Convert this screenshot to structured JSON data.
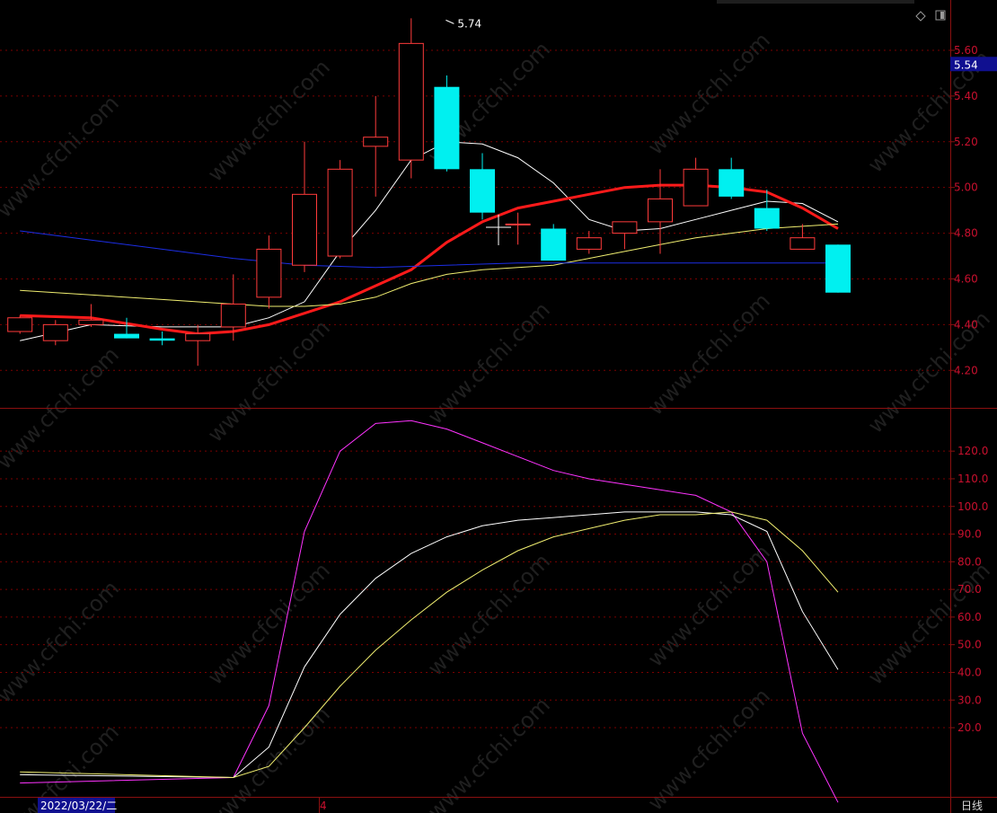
{
  "chart_data": [
    {
      "type": "candlestick",
      "panel": "price",
      "yticks": [
        4.2,
        4.4,
        4.6,
        4.8,
        5.0,
        5.2,
        5.4,
        5.6
      ],
      "ylim": [
        4.04,
        5.82
      ],
      "current_price_label": "5.54",
      "high_annotation": "5.74",
      "grid": true,
      "x": [
        -0.5,
        0.5,
        1.5,
        2.5,
        3.5,
        4.5,
        5.5,
        6.5,
        7.5,
        8.5,
        9.5,
        10.5,
        11.5,
        12.5,
        13.5,
        14.5,
        15.5,
        16.5,
        17.5,
        18.5,
        19.5,
        20.5,
        21.5,
        22.5
      ],
      "candles": [
        {
          "o": 4.37,
          "h": 4.44,
          "l": 4.36,
          "c": 4.43
        },
        {
          "o": 4.33,
          "h": 4.42,
          "l": 4.31,
          "c": 4.4
        },
        {
          "o": 4.4,
          "h": 4.49,
          "l": 4.39,
          "c": 4.42
        },
        {
          "o": 4.36,
          "h": 4.43,
          "l": 4.34,
          "c": 4.34
        },
        {
          "o": 4.34,
          "h": 4.37,
          "l": 4.31,
          "c": 4.33
        },
        {
          "o": 4.33,
          "h": 4.4,
          "l": 4.22,
          "c": 4.36
        },
        {
          "o": 4.39,
          "h": 4.62,
          "l": 4.33,
          "c": 4.49
        },
        {
          "o": 4.52,
          "h": 4.79,
          "l": 4.47,
          "c": 4.73
        },
        {
          "o": 4.66,
          "h": 5.2,
          "l": 4.63,
          "c": 4.97
        },
        {
          "o": 4.7,
          "h": 5.12,
          "l": 4.69,
          "c": 5.08
        },
        {
          "o": 5.18,
          "h": 5.4,
          "l": 4.96,
          "c": 5.22
        },
        {
          "o": 5.12,
          "h": 5.74,
          "l": 5.04,
          "c": 5.63
        },
        {
          "o": 5.44,
          "h": 5.49,
          "l": 5.07,
          "c": 5.08
        },
        {
          "o": 5.08,
          "h": 5.15,
          "l": 4.86,
          "c": 4.89
        },
        {
          "o": 4.84,
          "h": 4.89,
          "l": 4.75,
          "c": 4.84
        },
        {
          "o": 4.82,
          "h": 4.84,
          "l": 4.68,
          "c": 4.68
        },
        {
          "o": 4.73,
          "h": 4.81,
          "l": 4.71,
          "c": 4.78
        },
        {
          "o": 4.8,
          "h": 4.85,
          "l": 4.73,
          "c": 4.85
        },
        {
          "o": 4.85,
          "h": 5.08,
          "l": 4.71,
          "c": 4.95
        },
        {
          "o": 4.92,
          "h": 5.13,
          "l": 4.92,
          "c": 5.08
        },
        {
          "o": 5.08,
          "h": 5.13,
          "l": 4.95,
          "c": 4.96
        },
        {
          "o": 4.91,
          "h": 4.99,
          "l": 4.81,
          "c": 4.82
        },
        {
          "o": 4.73,
          "h": 4.84,
          "l": 4.73,
          "c": 4.78
        },
        {
          "o": 4.75,
          "h": 4.75,
          "l": 4.54,
          "c": 4.54
        }
      ],
      "series": [
        {
          "color": "#ffffff",
          "width": 1,
          "points": [
            [
              -0.5,
              4.33
            ],
            [
              1.5,
              4.4
            ],
            [
              3.5,
              4.39
            ],
            [
              5.5,
              4.39
            ],
            [
              6.5,
              4.43
            ],
            [
              7.5,
              4.5
            ],
            [
              8.5,
              4.72
            ],
            [
              9.5,
              4.9
            ],
            [
              10.5,
              5.12
            ],
            [
              11.5,
              5.2
            ],
            [
              12.5,
              5.19
            ],
            [
              13.5,
              5.13
            ],
            [
              14.5,
              5.02
            ],
            [
              15.5,
              4.86
            ],
            [
              16.5,
              4.81
            ],
            [
              17.5,
              4.82
            ],
            [
              18.5,
              4.86
            ],
            [
              19.5,
              4.9
            ],
            [
              20.5,
              4.94
            ],
            [
              21.5,
              4.93
            ],
            [
              22.5,
              4.85
            ]
          ]
        },
        {
          "color": "#ff1a1a",
          "width": 3,
          "points": [
            [
              -0.5,
              4.44
            ],
            [
              1.5,
              4.43
            ],
            [
              3.5,
              4.38
            ],
            [
              4.5,
              4.36
            ],
            [
              5.5,
              4.37
            ],
            [
              6.5,
              4.4
            ],
            [
              7.5,
              4.45
            ],
            [
              8.5,
              4.5
            ],
            [
              9.5,
              4.57
            ],
            [
              10.5,
              4.64
            ],
            [
              11.5,
              4.76
            ],
            [
              12.5,
              4.85
            ],
            [
              13.5,
              4.91
            ],
            [
              14.5,
              4.94
            ],
            [
              15.5,
              4.97
            ],
            [
              16.5,
              5.0
            ],
            [
              17.5,
              5.01
            ],
            [
              18.5,
              5.01
            ],
            [
              19.5,
              5.0
            ],
            [
              20.5,
              4.98
            ],
            [
              21.5,
              4.91
            ],
            [
              22.5,
              4.82
            ]
          ]
        },
        {
          "color": "#f0ee70",
          "width": 1,
          "points": [
            [
              -0.5,
              4.55
            ],
            [
              1.5,
              4.53
            ],
            [
              3.5,
              4.51
            ],
            [
              5.5,
              4.49
            ],
            [
              6.5,
              4.48
            ],
            [
              7.5,
              4.48
            ],
            [
              8.5,
              4.49
            ],
            [
              9.5,
              4.52
            ],
            [
              10.5,
              4.58
            ],
            [
              11.5,
              4.62
            ],
            [
              12.5,
              4.64
            ],
            [
              13.5,
              4.65
            ],
            [
              14.5,
              4.66
            ],
            [
              15.5,
              4.69
            ],
            [
              16.5,
              4.72
            ],
            [
              17.5,
              4.75
            ],
            [
              18.5,
              4.78
            ],
            [
              19.5,
              4.8
            ],
            [
              20.5,
              4.82
            ],
            [
              21.5,
              4.83
            ],
            [
              22.5,
              4.84
            ]
          ]
        },
        {
          "color": "#1c2ee6",
          "width": 1,
          "points": [
            [
              -0.5,
              4.81
            ],
            [
              1.5,
              4.77
            ],
            [
              3.5,
              4.73
            ],
            [
              5.5,
              4.69
            ],
            [
              7.5,
              4.66
            ],
            [
              9.5,
              4.65
            ],
            [
              11.5,
              4.66
            ],
            [
              13.5,
              4.67
            ],
            [
              15.5,
              4.67
            ],
            [
              17.5,
              4.67
            ],
            [
              19.5,
              4.67
            ],
            [
              21.5,
              4.67
            ],
            [
              22.5,
              4.67
            ]
          ]
        }
      ]
    },
    {
      "type": "line",
      "panel": "indicator",
      "yticks": [
        20.0,
        30.0,
        40.0,
        50.0,
        60.0,
        70.0,
        80.0,
        90.0,
        100.0,
        110.0,
        120.0
      ],
      "ylim": [
        -5,
        135
      ],
      "grid": true,
      "series": [
        {
          "color": "#ff33ff",
          "points": [
            [
              -0.5,
              0
            ],
            [
              5.5,
              2
            ],
            [
              6.5,
              28
            ],
            [
              7.5,
              91
            ],
            [
              8.5,
              120
            ],
            [
              9.5,
              130
            ],
            [
              10.5,
              131
            ],
            [
              11.5,
              128
            ],
            [
              12.5,
              123
            ],
            [
              13.5,
              118
            ],
            [
              14.5,
              113
            ],
            [
              15.5,
              110
            ],
            [
              16.5,
              108
            ],
            [
              17.5,
              106
            ],
            [
              18.5,
              104
            ],
            [
              19.5,
              98
            ],
            [
              20.5,
              80
            ],
            [
              21.5,
              18
            ],
            [
              22.5,
              -7
            ]
          ]
        },
        {
          "color": "#ffffff",
          "points": [
            [
              -0.5,
              3
            ],
            [
              5.5,
              2
            ],
            [
              6.5,
              13
            ],
            [
              7.5,
              42
            ],
            [
              8.5,
              61
            ],
            [
              9.5,
              74
            ],
            [
              10.5,
              83
            ],
            [
              11.5,
              89
            ],
            [
              12.5,
              93
            ],
            [
              13.5,
              95
            ],
            [
              14.5,
              96
            ],
            [
              15.5,
              97
            ],
            [
              16.5,
              98
            ],
            [
              17.5,
              98
            ],
            [
              18.5,
              98
            ],
            [
              19.5,
              97
            ],
            [
              20.5,
              91
            ],
            [
              21.5,
              62
            ],
            [
              22.5,
              41
            ]
          ]
        },
        {
          "color": "#f0ee70",
          "points": [
            [
              -0.5,
              4
            ],
            [
              5.5,
              2
            ],
            [
              6.5,
              6
            ],
            [
              7.5,
              20
            ],
            [
              8.5,
              35
            ],
            [
              9.5,
              48
            ],
            [
              10.5,
              59
            ],
            [
              11.5,
              69
            ],
            [
              12.5,
              77
            ],
            [
              13.5,
              84
            ],
            [
              14.5,
              89
            ],
            [
              15.5,
              92
            ],
            [
              16.5,
              95
            ],
            [
              17.5,
              97
            ],
            [
              18.5,
              97
            ],
            [
              19.5,
              98
            ],
            [
              20.5,
              95
            ],
            [
              21.5,
              84
            ],
            [
              22.5,
              69
            ]
          ]
        }
      ]
    }
  ],
  "xaxis": {
    "date_label": "2022/03/22/二",
    "month_label": "4",
    "period_label": "日线"
  },
  "watermark": "www.cfchi.com",
  "colors": {
    "up": "#ff3b3b",
    "down": "#00f0f0",
    "grid": "#7a0000",
    "axis": "#8b1010",
    "price_tag_bg": "#101090",
    "price_tag_text": "#ffffff"
  }
}
